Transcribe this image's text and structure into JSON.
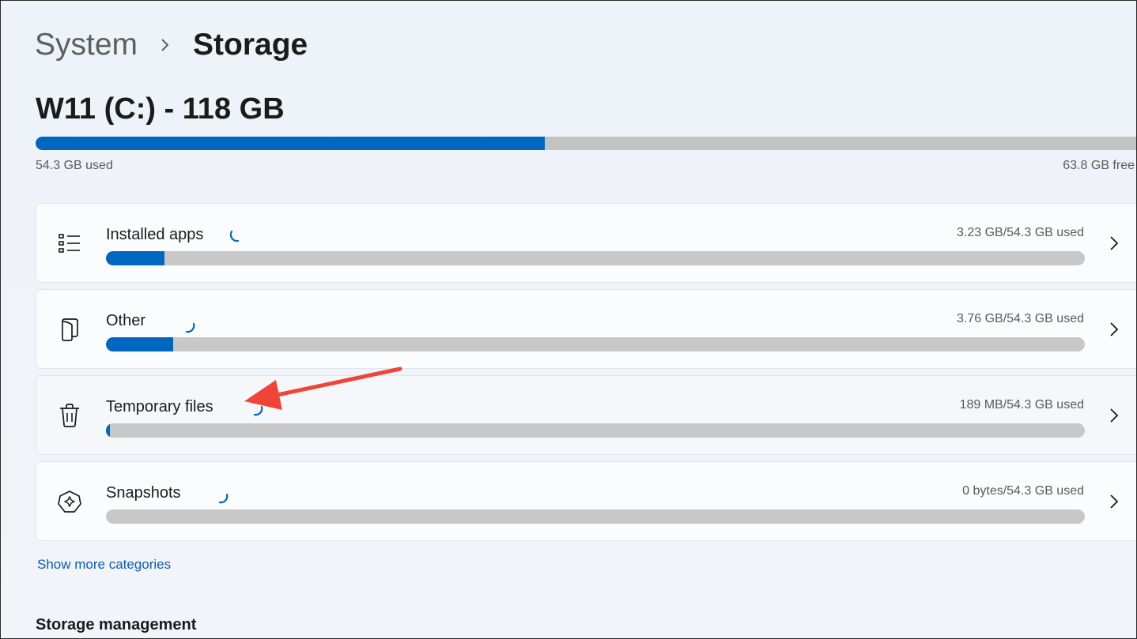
{
  "breadcrumb": {
    "parent": "System",
    "current": "Storage"
  },
  "drive": {
    "title": "W11 (C:) - 118 GB",
    "used_label": "54.3 GB used",
    "free_label": "63.8 GB free",
    "used_fraction": 0.46
  },
  "categories": [
    {
      "label": "Installed apps",
      "size": "3.23 GB/54.3 GB used",
      "fraction": 0.06,
      "icon": "list-icon"
    },
    {
      "label": "Other",
      "size": "3.76 GB/54.3 GB used",
      "fraction": 0.069,
      "icon": "document-icon"
    },
    {
      "label": "Temporary files",
      "size": "189 MB/54.3 GB used",
      "fraction": 0.0035,
      "icon": "trash-icon"
    },
    {
      "label": "Snapshots",
      "size": "0 bytes/54.3 GB used",
      "fraction": 0.0,
      "icon": "snapshot-icon"
    }
  ],
  "show_more": "Show more categories",
  "storage_management": "Storage management",
  "colors": {
    "accent": "#0067c0",
    "track": "#c8c8c8",
    "annotation_arrow": "#f04438"
  }
}
